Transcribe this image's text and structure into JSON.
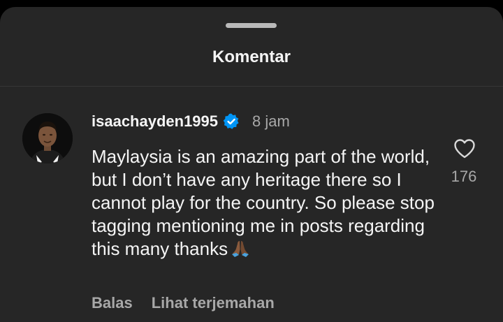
{
  "sheet": {
    "title": "Komentar"
  },
  "comment": {
    "avatar_icon": "user-avatar",
    "username": "isaachayden1995",
    "verified_icon": "verified-badge-icon",
    "time": "8 jam",
    "text": "Maylaysia is an amazing part of the world, but I don’t have any heritage there so I cannot play for the country. So please stop tagging mentioning me in posts regarding this many thanks",
    "emoji": "folded-hands-emoji",
    "reply_label": "Balas",
    "translate_label": "Lihat terjemahan",
    "like_icon": "heart-icon",
    "like_count": "176"
  },
  "colors": {
    "sheet_background": "#262626",
    "primary_text": "#f5f5f5",
    "secondary_text": "#a8a8a8",
    "verified_blue": "#0095f6"
  }
}
